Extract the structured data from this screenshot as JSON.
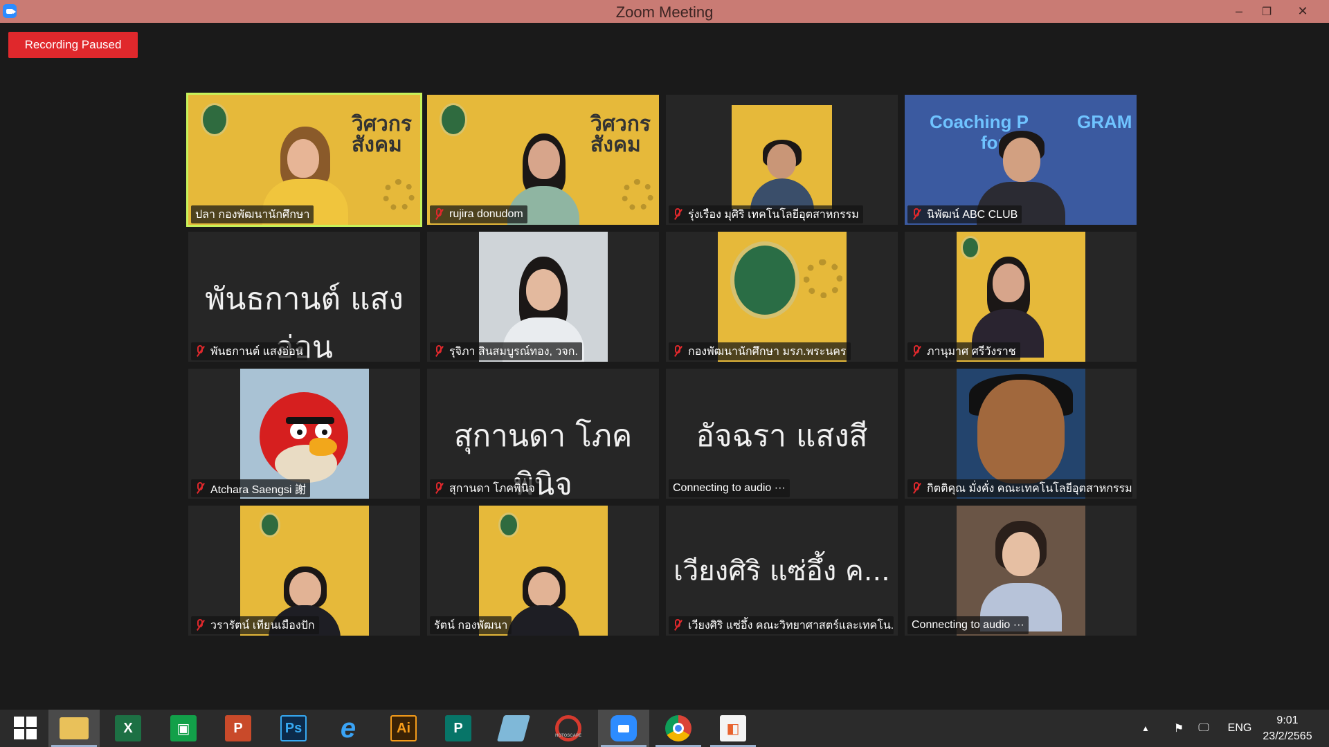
{
  "window": {
    "title": "Zoom Meeting",
    "minimize": "–",
    "restore": "❐",
    "close": "✕"
  },
  "recording": {
    "label": "Recording Paused",
    "color": "#e0282c"
  },
  "colors": {
    "active_speaker_border": "#c6f25b",
    "muted_icon": "#e0282c"
  },
  "participants": [
    {
      "name": "ปลา กองพัฒนานักศึกษา",
      "muted": false,
      "active": true,
      "video": "poster-person"
    },
    {
      "name": "rujira donudom",
      "muted": true,
      "video": "poster-person"
    },
    {
      "name": "รุ่งเรือง มุศิริ เทคโนโลยีอุตสาหกรรม",
      "muted": true,
      "video": "poster-person"
    },
    {
      "name": "นิพัฒน์ ABC CLUB",
      "muted": true,
      "video": "coaching",
      "banner_1": "Coaching P",
      "banner_2": "for",
      "banner_3": "GRAM"
    },
    {
      "name": "พันธกานต์ แสงอ่อน",
      "muted": true,
      "display": "พันธกานต์ แสงอ่อน"
    },
    {
      "name": "รุจิภา สินสมบูรณ์ทอง, วจก.",
      "muted": true,
      "video": "photo"
    },
    {
      "name": "กองพัฒนานักศึกษา มรภ.พระนคร",
      "muted": true,
      "video": "university-logo"
    },
    {
      "name": "ภานุมาศ ศรีวังราช",
      "muted": true,
      "video": "poster-person"
    },
    {
      "name": "Atchara Saengsi 謝",
      "muted": true,
      "video": "angry-bird"
    },
    {
      "name": "สุกานดา โภคพินิจ",
      "muted": true,
      "display": "สุกานดา โภคพินิจ"
    },
    {
      "name": "Connecting to audio ···",
      "muted": false,
      "display": "อัจฉรา แสงสี"
    },
    {
      "name": "กิตติคุณ มั่งคั่ง คณะเทคโนโลยีอุตสาหกรรม",
      "muted": true,
      "video": "cartoon"
    },
    {
      "name": "วรารัตน์ เทียนเมืองปัก",
      "muted": true,
      "video": "poster-person"
    },
    {
      "name": "รัตน์ กองพัฒนา",
      "muted": false,
      "video": "poster-person"
    },
    {
      "name": "เวียงศิริ แซ่อึ้ง คณะวิทยาศาสตร์และเทคโน...",
      "muted": true,
      "display": "เวียงศิริ แซ่อึ้ง ค..."
    },
    {
      "name": "Connecting to audio ···",
      "muted": false,
      "video": "photo"
    }
  ],
  "poster_title": "วิศวกร\nสังคม",
  "taskbar": {
    "apps": [
      "start-button",
      "file-explorer",
      "excel",
      "store",
      "powerpoint",
      "photoshop",
      "internet-explorer",
      "illustrator",
      "publisher",
      "notepad",
      "photoscape",
      "zoom",
      "chrome",
      "photos"
    ],
    "app_labels": {
      "excel": "X",
      "powerpoint": "P",
      "photoshop": "Ps",
      "illustrator": "Ai",
      "publisher": "P",
      "photoscape": "HOTOSCAPE"
    },
    "language": "ENG",
    "time": "9:01",
    "date": "23/2/2565"
  }
}
